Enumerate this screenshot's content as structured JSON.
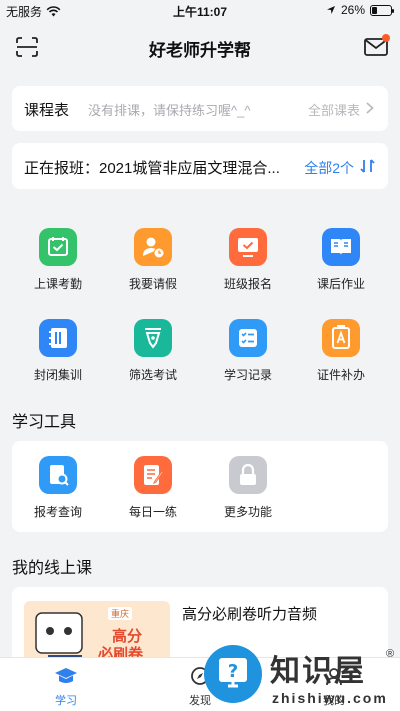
{
  "status_bar": {
    "carrier": "无服务",
    "time": "上午11:07",
    "battery": "26%",
    "battery_level": 0.26
  },
  "header": {
    "title": "好老师升学帮",
    "left_icon": "scan-icon",
    "right_icon": "mail-icon"
  },
  "schedule": {
    "title": "课程表",
    "empty_message": "没有排课，请保持练习喔^_^",
    "view_all": "全部课表"
  },
  "enrolling": {
    "text": "正在报班：2021城管非应届文理混合...",
    "view_all": "全部2个"
  },
  "features": [
    {
      "label": "上课考勤",
      "icon": "calendar-check-icon",
      "color": "#34c26b"
    },
    {
      "label": "我要请假",
      "icon": "person-clock-icon",
      "color": "#ff9a2e"
    },
    {
      "label": "班级报名",
      "icon": "monitor-check-icon",
      "color": "#ff6b3d"
    },
    {
      "label": "课后作业",
      "icon": "book-open-icon",
      "color": "#2f86f6"
    },
    {
      "label": "封闭集训",
      "icon": "notebook-icon",
      "color": "#2f86f6"
    },
    {
      "label": "筛选考试",
      "icon": "pen-nib-icon",
      "color": "#19b89a"
    },
    {
      "label": "学习记录",
      "icon": "checklist-icon",
      "color": "#2f9bf6"
    },
    {
      "label": "证件补办",
      "icon": "id-badge-icon",
      "color": "#ff9a2e"
    }
  ],
  "tools": {
    "section_title": "学习工具",
    "items": [
      {
        "label": "报考查询",
        "icon": "search-doc-icon",
        "color": "#2f9bf6"
      },
      {
        "label": "每日一练",
        "icon": "notepad-pen-icon",
        "color": "#ff6b3d"
      },
      {
        "label": "更多功能",
        "icon": "lock-icon",
        "color": "#c8cacf"
      }
    ]
  },
  "online": {
    "section_title": "我的线上课",
    "course_name": "高分必刷卷听力音频",
    "thumb_tag": "重庆",
    "thumb_line1": "高分",
    "thumb_line2": "必刷卷"
  },
  "tabbar": {
    "tabs": [
      {
        "label": "学习",
        "active": true
      },
      {
        "label": "发现",
        "active": false
      },
      {
        "label": "我的",
        "active": false
      }
    ]
  },
  "watermark": {
    "brand": "知识屋",
    "url": "zhishiwu.com",
    "reg": "®"
  }
}
